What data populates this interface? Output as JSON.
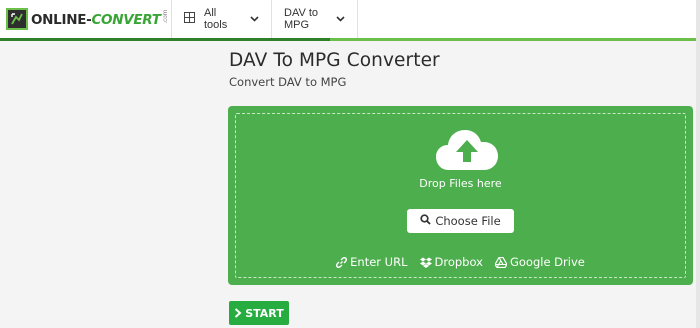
{
  "header": {
    "logo": {
      "text_main": "ONLINE-",
      "text_accent": "CONVERT",
      "text_suffix": ".com"
    },
    "nav": {
      "all_tools_label": "All tools",
      "converter_label": "DAV to MPG"
    }
  },
  "main": {
    "title": "DAV To MPG Converter",
    "subtitle": "Convert DAV to MPG"
  },
  "dropzone": {
    "drop_text": "Drop Files here",
    "choose_label": "Choose File",
    "sources": {
      "url_label": "Enter URL",
      "dropbox_label": "Dropbox",
      "gdrive_label": "Google Drive"
    }
  },
  "actions": {
    "start_label": "START"
  },
  "colors": {
    "brand_green": "#4cae4c",
    "start_green": "#27ad3f",
    "logo_green": "#3aa537"
  },
  "icons": [
    "logo-icon",
    "grid-icon",
    "chevron-down-icon",
    "cloud-upload-icon",
    "search-icon",
    "link-icon",
    "dropbox-icon",
    "google-drive-icon",
    "chevron-right-icon"
  ]
}
